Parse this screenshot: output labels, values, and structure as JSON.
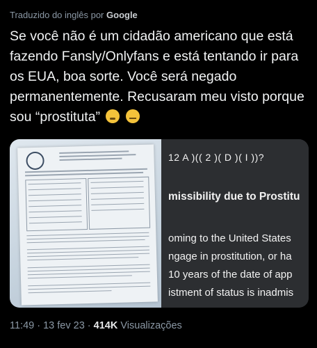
{
  "translation": {
    "prefix": "Traduzido do inglês por",
    "brand": "Google"
  },
  "tweet": {
    "text": "Se você não é um cidadão americano que está fazendo Fansly/Onlyfans e está tentando ir para os EUA, boa sorte. Você será negado permanentemente. Recusaram meu visto porque sou “prostituta”"
  },
  "emojis": [
    "face-with-raised-eyebrow-icon",
    "expressionless-face-icon"
  ],
  "media": {
    "document_lines": [
      "12 A )(( 2 )( D )( I ))?",
      "missibility due to Prostitu",
      "oming to the United States",
      "ngage in prostitution, or ha",
      "10 years of the date of app",
      "istment of status is inadmis"
    ]
  },
  "meta": {
    "time": "11:49",
    "sep1": " · ",
    "date": "13 fev 23",
    "sep2": " · ",
    "views_count": "414K",
    "views_label": " Visualizações"
  }
}
